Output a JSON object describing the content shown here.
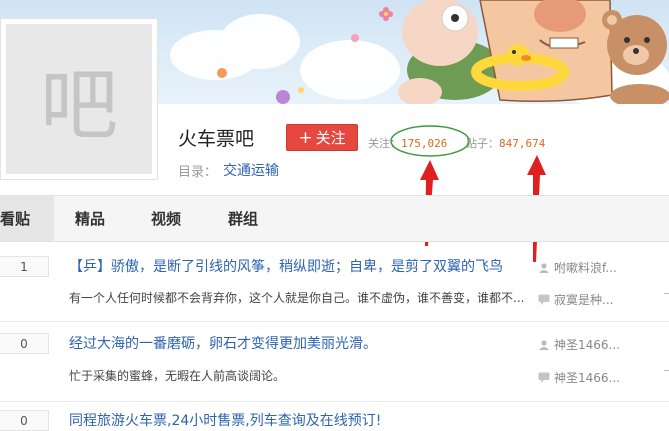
{
  "forum": {
    "name": "火车票吧",
    "follow_label": "关注",
    "follow_plus": "+",
    "stats": {
      "followers_label": "关注：",
      "followers_value": "175,026",
      "posts_label": "贴子：",
      "posts_value": "847,674"
    },
    "category_label": "目录：",
    "category_value": "交通运输",
    "avatar_glyph": "吧"
  },
  "tabs": [
    {
      "label": "看贴",
      "active": true
    },
    {
      "label": "精品",
      "active": false
    },
    {
      "label": "视频",
      "active": false
    },
    {
      "label": "群组",
      "active": false
    }
  ],
  "threads": [
    {
      "reply_count": "1",
      "title": "【乒】骄傲，是断了引线的风筝，稍纵即逝；自卑，是剪了双翼的飞鸟",
      "abstract": "有一个人任何时候都不会背弃你，这个人就是你自己。谁不虚伪，谁不善变，谁都不...",
      "author": "咐嗽料浪f...",
      "last_reply": "寂寞是种..."
    },
    {
      "reply_count": "0",
      "title": "经过大海的一番磨砺，卵石才变得更加美丽光滑。",
      "abstract": "忙于采集的蜜蜂，无暇在人前高谈阔论。",
      "author": "神圣1466...",
      "last_reply": "神圣1466..."
    },
    {
      "reply_count": "0",
      "title": "同程旅游火车票,24小时售票,列车查询及在线预订!",
      "abstract": "",
      "author": "",
      "last_reply": ""
    }
  ],
  "colors": {
    "accent_red": "#e5483e",
    "link_blue": "#2d64b3",
    "stat_orange": "#e06a1e",
    "annotation_red": "#e02020",
    "annotation_green": "#3f9b3f"
  },
  "icons": [
    "user-icon",
    "comment-icon"
  ]
}
